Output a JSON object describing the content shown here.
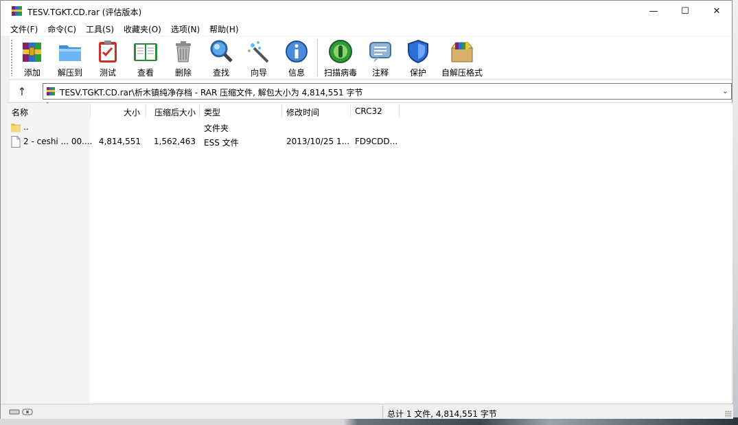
{
  "window": {
    "title": "TESV.TGKT.CD.rar (评估版本)",
    "controls": {
      "minimize": "—",
      "maximize": "☐",
      "close": "✕"
    }
  },
  "menu": [
    "文件(F)",
    "命令(C)",
    "工具(S)",
    "收藏夹(O)",
    "选项(N)",
    "帮助(H)"
  ],
  "toolbar": [
    {
      "label": "添加",
      "icon": "archive-add-icon"
    },
    {
      "label": "解压到",
      "icon": "folder-extract-icon"
    },
    {
      "label": "测试",
      "icon": "clipboard-test-icon"
    },
    {
      "label": "查看",
      "icon": "book-view-icon"
    },
    {
      "label": "删除",
      "icon": "trash-icon"
    },
    {
      "label": "查找",
      "icon": "magnifier-icon"
    },
    {
      "label": "向导",
      "icon": "wizard-wand-icon"
    },
    {
      "label": "信息",
      "icon": "info-icon"
    },
    {
      "label": "扫描病毒",
      "icon": "virus-scan-icon"
    },
    {
      "label": "注释",
      "icon": "comment-icon"
    },
    {
      "label": "保护",
      "icon": "shield-icon"
    },
    {
      "label": "自解压格式",
      "icon": "sfx-box-icon"
    }
  ],
  "address": {
    "up_symbol": "↑",
    "path": "TESV.TGKT.CD.rar\\析木镇纯净存档 - RAR 压缩文件, 解包大小为 4,814,551 字节",
    "dropdown_symbol": "⌄"
  },
  "columns": {
    "name": "名称",
    "size": "大小",
    "packed": "压缩后大小",
    "type": "类型",
    "modified": "修改时间",
    "crc": "CRC32",
    "sort_indicator": "ˇ"
  },
  "rows": [
    {
      "name": "..",
      "size": "",
      "packed": "",
      "type": "文件夹",
      "modified": "",
      "crc": "",
      "icon": "folder-icon"
    },
    {
      "name": "2 - ceshi ... 00....",
      "size": "4,814,551",
      "packed": "1,562,463",
      "type": "ESS 文件",
      "modified": "2013/10/25 1...",
      "crc": "FD9CDD...",
      "icon": "file-icon"
    }
  ],
  "status": {
    "summary": "总计 1 文件, 4,814,551 字节"
  },
  "colors": {
    "accent_blue": "#1e6fd0",
    "window_bg": "#f0f0f0",
    "list_bg": "#ffffff"
  }
}
